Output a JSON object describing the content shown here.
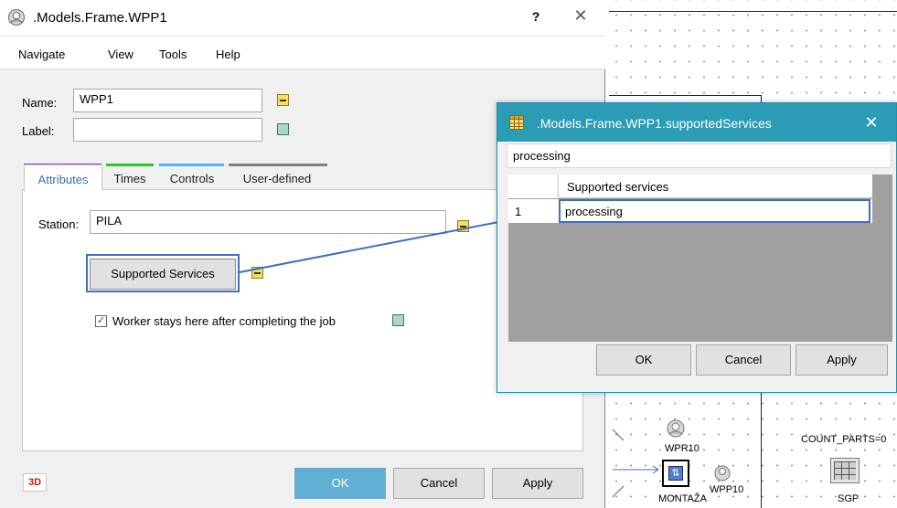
{
  "main_dialog": {
    "title": ".Models.Frame.WPP1",
    "help_label": "?",
    "close_label": "✕",
    "menu": [
      "Navigate",
      "View",
      "Tools",
      "Help"
    ],
    "name_label": "Name:",
    "name_value": "WPP1",
    "label_label": "Label:",
    "label_value": "",
    "tabs": [
      {
        "label": "Attributes",
        "color": "#9b30c8"
      },
      {
        "label": "Times",
        "color": "#22cc22"
      },
      {
        "label": "Controls",
        "color": "#4fb8f0"
      },
      {
        "label": "User-defined",
        "color": "#808080"
      }
    ],
    "station_label": "Station:",
    "station_value": "PILA",
    "supported_services_button": "Supported Services",
    "worker_checkbox_label": "Worker stays here after completing the job",
    "worker_checkbox_checked": true,
    "btn_3d": "3D",
    "ok": "OK",
    "cancel": "Cancel",
    "apply": "Apply"
  },
  "services_dialog": {
    "title": ".Models.Frame.WPP1.supportedServices",
    "close_label": "✕",
    "filter_value": "processing",
    "column_header": "Supported services",
    "rows": [
      {
        "num": "1",
        "value": "processing"
      }
    ],
    "ok": "OK",
    "cancel": "Cancel",
    "apply": "Apply"
  },
  "canvas": {
    "labels": {
      "wpr10": "WPR10",
      "wpp10": "WPP10",
      "montaza": "MONTAŽA",
      "count_parts": "COUNT_PARTS=0",
      "sgp": "SGP"
    }
  },
  "colors": {
    "accent_blue": "#3d6fc0",
    "dialog_title_teal": "#2b9bb6",
    "ok_button": "#61aed3"
  }
}
